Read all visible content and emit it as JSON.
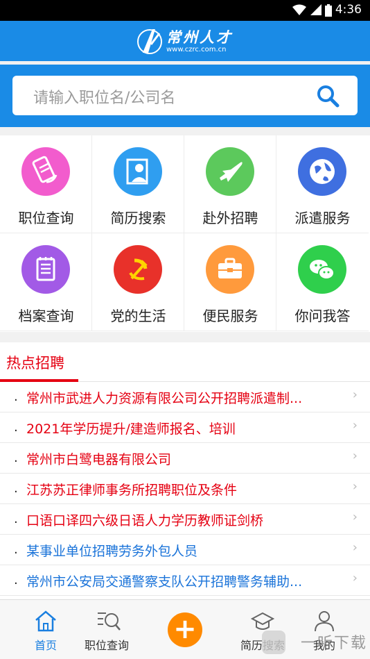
{
  "status_bar": {
    "time": "4:36"
  },
  "header": {
    "logo_title": "常州人才",
    "logo_url": "www.czrc.com.cn"
  },
  "search": {
    "placeholder": "请输入职位名/公司名"
  },
  "grid": [
    {
      "label": "职位查询",
      "icon": "job-search-icon",
      "color": "#f25ccd"
    },
    {
      "label": "简历搜索",
      "icon": "resume-icon",
      "color": "#2f9ef0"
    },
    {
      "label": "赴外招聘",
      "icon": "airplane-icon",
      "color": "#5cc95c"
    },
    {
      "label": "派遣服务",
      "icon": "globe-icon",
      "color": "#3f6fe0"
    },
    {
      "label": "档案查询",
      "icon": "file-icon",
      "color": "#a25ae6"
    },
    {
      "label": "党的生活",
      "icon": "party-emblem-icon",
      "color": "#e8312a"
    },
    {
      "label": "便民服务",
      "icon": "toolbox-icon",
      "color": "#ff9a3c"
    },
    {
      "label": "你问我答",
      "icon": "chat-icon",
      "color": "#2fcf4c"
    }
  ],
  "hot": {
    "title": "热点招聘",
    "items": [
      {
        "text": "常州市武进人力资源有限公司公开招聘派遣制...",
        "color": "#e50012"
      },
      {
        "text": "2021年学历提升/建造师报名、培训",
        "color": "#e50012"
      },
      {
        "text": "常州市白鹭电器有限公司",
        "color": "#e50012"
      },
      {
        "text": "江苏苏正律师事务所招聘职位及条件",
        "color": "#e50012"
      },
      {
        "text": "口语口译四六级日语人力学历教师证剑桥",
        "color": "#e50012"
      },
      {
        "text": "某事业单位招聘劳务外包人员",
        "color": "#1a73d9"
      },
      {
        "text": "常州市公安局交通警察支队公开招聘警务辅助...",
        "color": "#1a73d9"
      }
    ]
  },
  "tabbar": {
    "tabs": [
      {
        "label": "首页",
        "active": true
      },
      {
        "label": "职位查询",
        "active": false
      },
      {
        "label": "简历搜索",
        "active": false
      },
      {
        "label": "我的",
        "active": false
      }
    ],
    "plus_label": "+"
  },
  "watermark": "一听下载",
  "colors": {
    "primary": "#1a8be6",
    "hot_red": "#e50012",
    "accent_orange": "#ff8a00"
  }
}
